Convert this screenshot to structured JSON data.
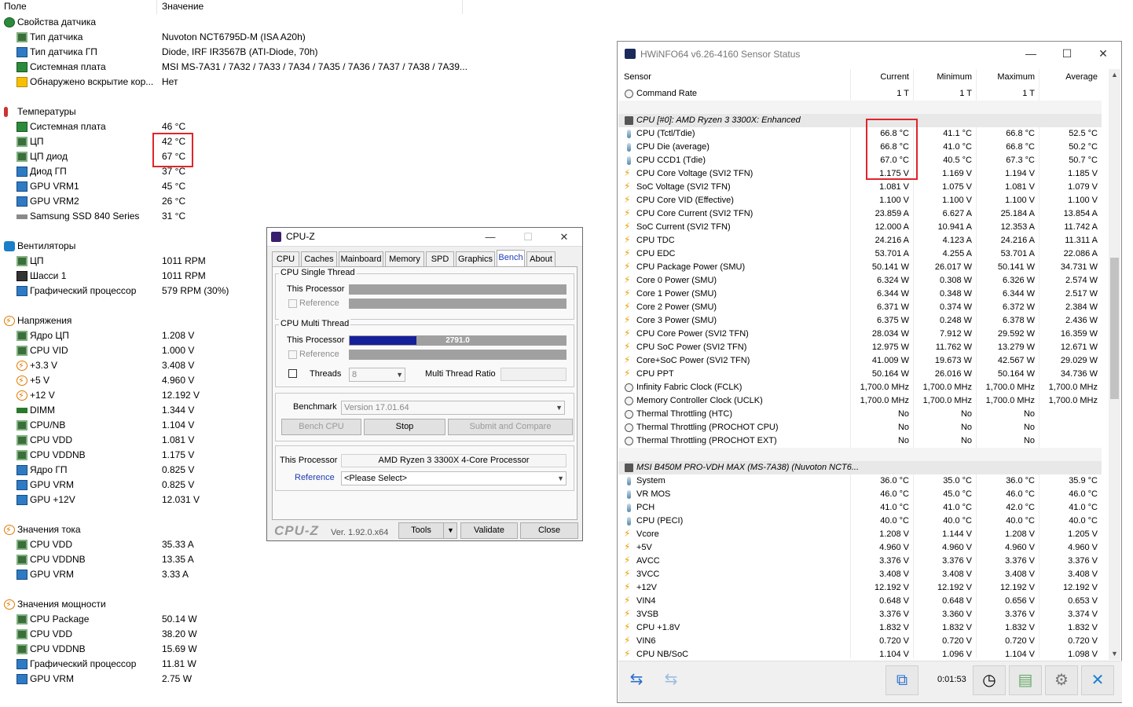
{
  "aida": {
    "header": {
      "field": "Поле",
      "value": "Значение"
    },
    "sections": [
      {
        "title": "Свойства датчика",
        "icon": "sensor-icon",
        "rows": [
          {
            "label": "Тип датчика",
            "value": "Nuvoton NCT6795D-M  (ISA A20h)",
            "icon": "chip-icon"
          },
          {
            "label": "Тип датчика ГП",
            "value": "Diode, IRF IR3567B  (ATI-Diode, 70h)",
            "icon": "monitor-icon"
          },
          {
            "label": "Системная плата",
            "value": "MSI MS-7A31 / 7A32 / 7A33 / 7A34 / 7A35 / 7A36 / 7A37 / 7A38 / 7A39...",
            "icon": "motherboard-icon"
          },
          {
            "label": "Обнаружено вскрытие кор...",
            "value": "Нет",
            "icon": "shield-icon"
          }
        ]
      },
      {
        "title": "Температуры",
        "icon": "thermometer-icon",
        "rows": [
          {
            "label": "Системная плата",
            "value": "46 °C",
            "icon": "motherboard-icon"
          },
          {
            "label": "ЦП",
            "value": "42 °C",
            "icon": "chip-icon"
          },
          {
            "label": "ЦП диод",
            "value": "67 °C",
            "icon": "chip-icon"
          },
          {
            "label": "Диод ГП",
            "value": "37 °C",
            "icon": "monitor-icon"
          },
          {
            "label": "GPU VRM1",
            "value": "45 °C",
            "icon": "monitor-icon"
          },
          {
            "label": "GPU VRM2",
            "value": "26 °C",
            "icon": "monitor-icon"
          },
          {
            "label": "Samsung SSD 840 Series",
            "value": "31 °C",
            "icon": "ssd-icon"
          }
        ]
      },
      {
        "title": "Вентиляторы",
        "icon": "fan-icon",
        "rows": [
          {
            "label": "ЦП",
            "value": "1011 RPM",
            "icon": "chip-icon"
          },
          {
            "label": "Шасси 1",
            "value": "1011 RPM",
            "icon": "tower-icon"
          },
          {
            "label": "Графический процессор",
            "value": "579 RPM  (30%)",
            "icon": "monitor-icon"
          }
        ]
      },
      {
        "title": "Напряжения",
        "icon": "voltage-icon",
        "rows": [
          {
            "label": "Ядро ЦП",
            "value": "1.208 V",
            "icon": "chip-icon"
          },
          {
            "label": "CPU VID",
            "value": "1.000 V",
            "icon": "chip-icon"
          },
          {
            "label": "+3.3 V",
            "value": "3.408 V",
            "icon": "bolt-icon"
          },
          {
            "label": "+5 V",
            "value": "4.960 V",
            "icon": "bolt-icon"
          },
          {
            "label": "+12 V",
            "value": "12.192 V",
            "icon": "bolt-icon"
          },
          {
            "label": "DIMM",
            "value": "1.344 V",
            "icon": "dimm-icon"
          },
          {
            "label": "CPU/NB",
            "value": "1.104 V",
            "icon": "chip-icon"
          },
          {
            "label": "CPU VDD",
            "value": "1.081 V",
            "icon": "chip-icon"
          },
          {
            "label": "CPU VDDNB",
            "value": "1.175 V",
            "icon": "chip-icon"
          },
          {
            "label": "Ядро ГП",
            "value": "0.825 V",
            "icon": "monitor-icon"
          },
          {
            "label": "GPU VRM",
            "value": "0.825 V",
            "icon": "monitor-icon"
          },
          {
            "label": "GPU +12V",
            "value": "12.031 V",
            "icon": "monitor-icon"
          }
        ]
      },
      {
        "title": "Значения тока",
        "icon": "current-icon",
        "rows": [
          {
            "label": "CPU VDD",
            "value": "35.33 A",
            "icon": "chip-icon"
          },
          {
            "label": "CPU VDDNB",
            "value": "13.35 A",
            "icon": "chip-icon"
          },
          {
            "label": "GPU VRM",
            "value": "3.33 A",
            "icon": "monitor-icon"
          }
        ]
      },
      {
        "title": "Значения мощности",
        "icon": "power-icon",
        "rows": [
          {
            "label": "CPU Package",
            "value": "50.14 W",
            "icon": "chip-icon"
          },
          {
            "label": "CPU VDD",
            "value": "38.20 W",
            "icon": "chip-icon"
          },
          {
            "label": "CPU VDDNB",
            "value": "15.69 W",
            "icon": "chip-icon"
          },
          {
            "label": "Графический процессор",
            "value": "11.81 W",
            "icon": "monitor-icon"
          },
          {
            "label": "GPU VRM",
            "value": "2.75 W",
            "icon": "monitor-icon"
          }
        ]
      }
    ]
  },
  "cpuz": {
    "title": "CPU-Z",
    "tabs": [
      "CPU",
      "Caches",
      "Mainboard",
      "Memory",
      "SPD",
      "Graphics",
      "Bench",
      "About"
    ],
    "active_tab": "Bench",
    "single_thread_group": "CPU Single Thread",
    "multi_thread_group": "CPU Multi Thread",
    "this_processor_label": "This Processor",
    "reference_label": "Reference",
    "multi_score": "2791.0",
    "multi_progress": 0.31,
    "threads_label": "Threads",
    "threads_value": "8",
    "mt_ratio_label": "Multi Thread Ratio",
    "benchmark_label": "Benchmark",
    "benchmark_version": "Version 17.01.64",
    "bench_cpu_label": "Bench CPU",
    "stop_label": "Stop",
    "submit_label": "Submit and Compare",
    "processor_name": "AMD Ryzen 3 3300X 4-Core Processor",
    "reference_select": "<Please Select>",
    "logo": "CPU-Z",
    "version": "Ver. 1.92.0.x64",
    "tools_label": "Tools",
    "validate_label": "Validate",
    "close_label": "Close",
    "min_glyph": "—",
    "max_glyph": "☐",
    "close_glyph": "✕"
  },
  "hwinfo": {
    "title": "HWiNFO64 v6.26-4160 Sensor Status",
    "columns": {
      "sensor": "Sensor",
      "current": "Current",
      "minimum": "Minimum",
      "maximum": "Maximum",
      "average": "Average"
    },
    "rows": [
      {
        "type": "clock",
        "name": "Command Rate",
        "cur": "1 T",
        "min": "1 T",
        "max": "1 T",
        "avg": ""
      },
      {
        "type": "blank"
      },
      {
        "type": "group",
        "name": "CPU [#0]: AMD Ryzen 3 3300X: Enhanced"
      },
      {
        "type": "therm",
        "name": "CPU (Tctl/Tdie)",
        "cur": "66.8 °C",
        "min": "41.1 °C",
        "max": "66.8 °C",
        "avg": "52.5 °C"
      },
      {
        "type": "therm",
        "name": "CPU Die (average)",
        "cur": "66.8 °C",
        "min": "41.0 °C",
        "max": "66.8 °C",
        "avg": "50.2 °C"
      },
      {
        "type": "therm",
        "name": "CPU CCD1 (Tdie)",
        "cur": "67.0 °C",
        "min": "40.5 °C",
        "max": "67.3 °C",
        "avg": "50.7 °C"
      },
      {
        "type": "bolt",
        "name": "CPU Core Voltage (SVI2 TFN)",
        "cur": "1.175 V",
        "min": "1.169 V",
        "max": "1.194 V",
        "avg": "1.185 V"
      },
      {
        "type": "bolt",
        "name": "SoC Voltage (SVI2 TFN)",
        "cur": "1.081 V",
        "min": "1.075 V",
        "max": "1.081 V",
        "avg": "1.079 V"
      },
      {
        "type": "bolt",
        "name": "CPU Core VID (Effective)",
        "cur": "1.100 V",
        "min": "1.100 V",
        "max": "1.100 V",
        "avg": "1.100 V"
      },
      {
        "type": "bolt",
        "name": "CPU Core Current (SVI2 TFN)",
        "cur": "23.859 A",
        "min": "6.627 A",
        "max": "25.184 A",
        "avg": "13.854 A"
      },
      {
        "type": "bolt",
        "name": "SoC Current (SVI2 TFN)",
        "cur": "12.000 A",
        "min": "10.941 A",
        "max": "12.353 A",
        "avg": "11.742 A"
      },
      {
        "type": "bolt",
        "name": "CPU TDC",
        "cur": "24.216 A",
        "min": "4.123 A",
        "max": "24.216 A",
        "avg": "11.311 A"
      },
      {
        "type": "bolt",
        "name": "CPU EDC",
        "cur": "53.701 A",
        "min": "4.255 A",
        "max": "53.701 A",
        "avg": "22.086 A"
      },
      {
        "type": "bolt",
        "name": "CPU Package Power (SMU)",
        "cur": "50.141 W",
        "min": "26.017 W",
        "max": "50.141 W",
        "avg": "34.731 W"
      },
      {
        "type": "bolt",
        "name": "Core 0 Power (SMU)",
        "cur": "6.324 W",
        "min": "0.308 W",
        "max": "6.326 W",
        "avg": "2.574 W"
      },
      {
        "type": "bolt",
        "name": "Core 1 Power (SMU)",
        "cur": "6.344 W",
        "min": "0.348 W",
        "max": "6.344 W",
        "avg": "2.517 W"
      },
      {
        "type": "bolt",
        "name": "Core 2 Power (SMU)",
        "cur": "6.371 W",
        "min": "0.374 W",
        "max": "6.372 W",
        "avg": "2.384 W"
      },
      {
        "type": "bolt",
        "name": "Core 3 Power (SMU)",
        "cur": "6.375 W",
        "min": "0.248 W",
        "max": "6.378 W",
        "avg": "2.436 W"
      },
      {
        "type": "bolt",
        "name": "CPU Core Power (SVI2 TFN)",
        "cur": "28.034 W",
        "min": "7.912 W",
        "max": "29.592 W",
        "avg": "16.359 W"
      },
      {
        "type": "bolt",
        "name": "CPU SoC Power (SVI2 TFN)",
        "cur": "12.975 W",
        "min": "11.762 W",
        "max": "13.279 W",
        "avg": "12.671 W"
      },
      {
        "type": "bolt",
        "name": "Core+SoC Power (SVI2 TFN)",
        "cur": "41.009 W",
        "min": "19.673 W",
        "max": "42.567 W",
        "avg": "29.029 W"
      },
      {
        "type": "bolt",
        "name": "CPU PPT",
        "cur": "50.164 W",
        "min": "26.016 W",
        "max": "50.164 W",
        "avg": "34.736 W"
      },
      {
        "type": "clock",
        "name": "Infinity Fabric Clock (FCLK)",
        "cur": "1,700.0 MHz",
        "min": "1,700.0 MHz",
        "max": "1,700.0 MHz",
        "avg": "1,700.0 MHz"
      },
      {
        "type": "clock",
        "name": "Memory Controller Clock (UCLK)",
        "cur": "1,700.0 MHz",
        "min": "1,700.0 MHz",
        "max": "1,700.0 MHz",
        "avg": "1,700.0 MHz"
      },
      {
        "type": "clock",
        "name": "Thermal Throttling (HTC)",
        "cur": "No",
        "min": "No",
        "max": "No",
        "avg": ""
      },
      {
        "type": "clock",
        "name": "Thermal Throttling (PROCHOT CPU)",
        "cur": "No",
        "min": "No",
        "max": "No",
        "avg": ""
      },
      {
        "type": "clock",
        "name": "Thermal Throttling (PROCHOT EXT)",
        "cur": "No",
        "min": "No",
        "max": "No",
        "avg": ""
      },
      {
        "type": "blank"
      },
      {
        "type": "group",
        "name": "MSI B450M PRO-VDH MAX (MS-7A38) (Nuvoton NCT6..."
      },
      {
        "type": "therm",
        "name": "System",
        "cur": "36.0 °C",
        "min": "35.0 °C",
        "max": "36.0 °C",
        "avg": "35.9 °C"
      },
      {
        "type": "therm",
        "name": "VR MOS",
        "cur": "46.0 °C",
        "min": "45.0 °C",
        "max": "46.0 °C",
        "avg": "46.0 °C"
      },
      {
        "type": "therm",
        "name": "PCH",
        "cur": "41.0 °C",
        "min": "41.0 °C",
        "max": "42.0 °C",
        "avg": "41.0 °C"
      },
      {
        "type": "therm",
        "name": "CPU (PECI)",
        "cur": "40.0 °C",
        "min": "40.0 °C",
        "max": "40.0 °C",
        "avg": "40.0 °C"
      },
      {
        "type": "bolt",
        "name": "Vcore",
        "cur": "1.208 V",
        "min": "1.144 V",
        "max": "1.208 V",
        "avg": "1.205 V"
      },
      {
        "type": "bolt",
        "name": "+5V",
        "cur": "4.960 V",
        "min": "4.960 V",
        "max": "4.960 V",
        "avg": "4.960 V"
      },
      {
        "type": "bolt",
        "name": "AVCC",
        "cur": "3.376 V",
        "min": "3.376 V",
        "max": "3.376 V",
        "avg": "3.376 V"
      },
      {
        "type": "bolt",
        "name": "3VCC",
        "cur": "3.408 V",
        "min": "3.408 V",
        "max": "3.408 V",
        "avg": "3.408 V"
      },
      {
        "type": "bolt",
        "name": "+12V",
        "cur": "12.192 V",
        "min": "12.192 V",
        "max": "12.192 V",
        "avg": "12.192 V"
      },
      {
        "type": "bolt",
        "name": "VIN4",
        "cur": "0.648 V",
        "min": "0.648 V",
        "max": "0.656 V",
        "avg": "0.653 V"
      },
      {
        "type": "bolt",
        "name": "3VSB",
        "cur": "3.376 V",
        "min": "3.360 V",
        "max": "3.376 V",
        "avg": "3.374 V"
      },
      {
        "type": "bolt",
        "name": "CPU +1.8V",
        "cur": "1.832 V",
        "min": "1.832 V",
        "max": "1.832 V",
        "avg": "1.832 V"
      },
      {
        "type": "bolt",
        "name": "VIN6",
        "cur": "0.720 V",
        "min": "0.720 V",
        "max": "0.720 V",
        "avg": "0.720 V"
      },
      {
        "type": "bolt",
        "name": "CPU NB/SoC",
        "cur": "1.104 V",
        "min": "1.096 V",
        "max": "1.104 V",
        "avg": "1.098 V"
      }
    ],
    "elapsed": "0:01:53",
    "min_glyph": "—",
    "max_glyph": "☐",
    "close_glyph": "✕"
  },
  "colors": {
    "highlight_box": "#e0252b",
    "bench_bar": "#14209a"
  }
}
